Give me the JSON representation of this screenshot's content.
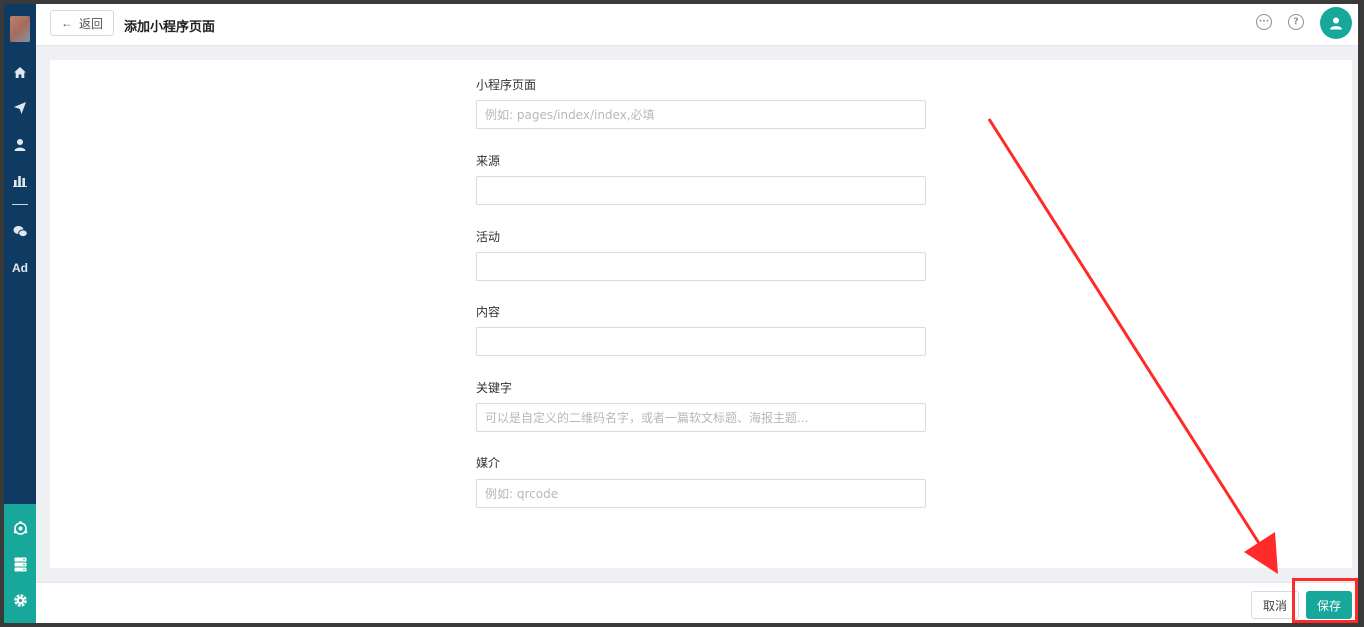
{
  "header": {
    "back_label": "返回",
    "title": "添加小程序页面"
  },
  "sidebar": {
    "items": [
      {
        "icon": "home-icon"
      },
      {
        "icon": "send-icon"
      },
      {
        "icon": "user-icon"
      },
      {
        "icon": "bar-chart-icon"
      },
      {
        "icon": "wechat-icon"
      },
      {
        "label": "Ad"
      }
    ],
    "bottom_items": [
      {
        "icon": "target-icon"
      },
      {
        "icon": "server-icon"
      },
      {
        "icon": "gear-icon"
      }
    ]
  },
  "form": {
    "fields": [
      {
        "label": "小程序页面",
        "placeholder": "例如: pages/index/index,必填",
        "value": ""
      },
      {
        "label": "来源",
        "placeholder": "",
        "value": ""
      },
      {
        "label": "活动",
        "placeholder": "",
        "value": ""
      },
      {
        "label": "内容",
        "placeholder": "",
        "value": ""
      },
      {
        "label": "关键字",
        "placeholder": "可以是自定义的二维码名字，或者一篇软文标题、海报主题...",
        "value": ""
      },
      {
        "label": "媒介",
        "placeholder": "例如: qrcode",
        "value": ""
      }
    ]
  },
  "footer": {
    "cancel_label": "取消",
    "save_label": "保存"
  },
  "colors": {
    "sidebar": "#0f3b63",
    "accent": "#17a79b",
    "annotation": "#ff2a2a"
  }
}
